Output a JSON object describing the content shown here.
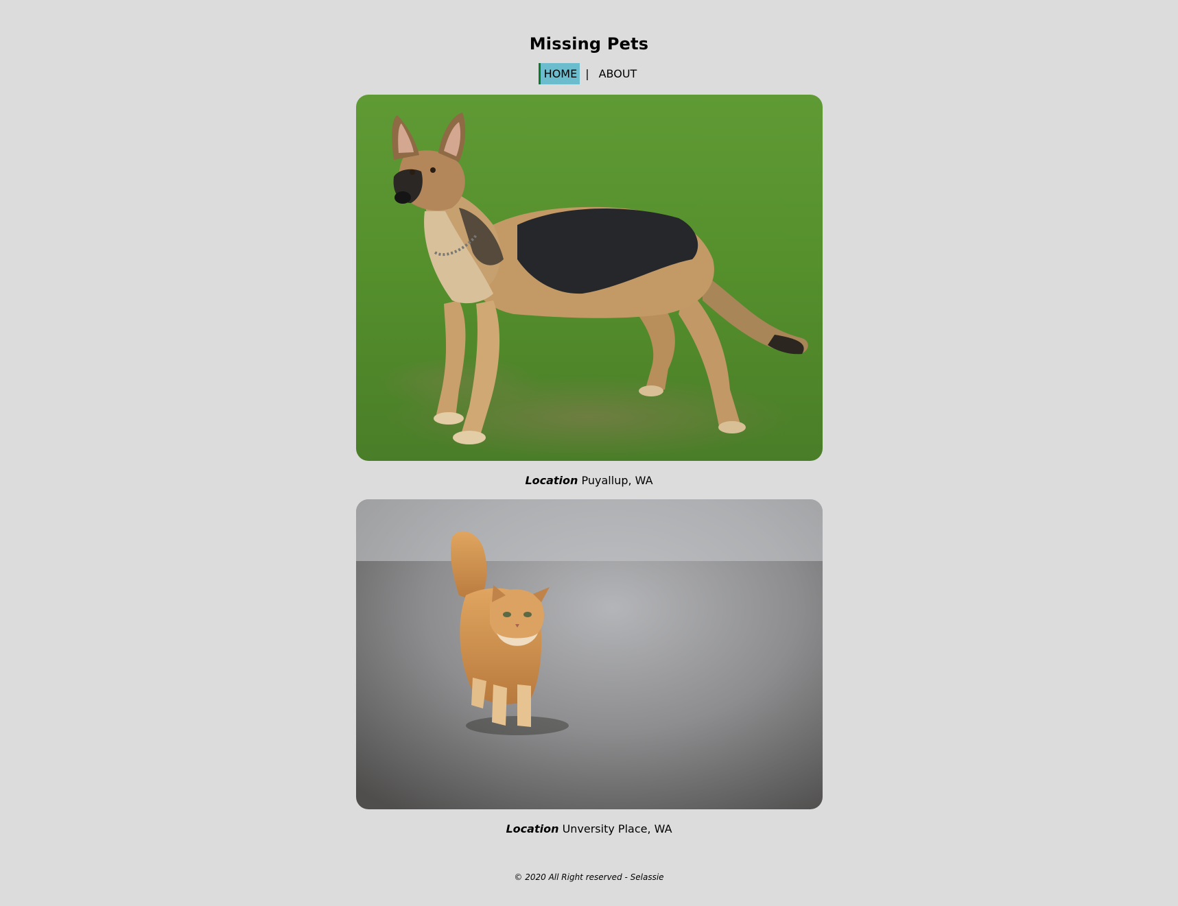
{
  "header": {
    "title": "Missing Pets"
  },
  "nav": {
    "items": [
      {
        "label": "HOME",
        "active": true
      },
      {
        "label": "ABOUT",
        "active": false
      }
    ],
    "separator": "|",
    "active_bg": "#6bbccc",
    "active_border": "#0a7a2c"
  },
  "pets": [
    {
      "photo_subject": "german-shepherd-dog",
      "location_label": "Location",
      "location_value": "Puyallup, WA"
    },
    {
      "photo_subject": "orange-long-haired-cat",
      "location_label": "Location",
      "location_value": "Unversity Place, WA"
    }
  ],
  "footer": {
    "text": "© 2020 All Right reserved - Selassie"
  },
  "colors": {
    "page_bg": "#dcdcdc"
  }
}
